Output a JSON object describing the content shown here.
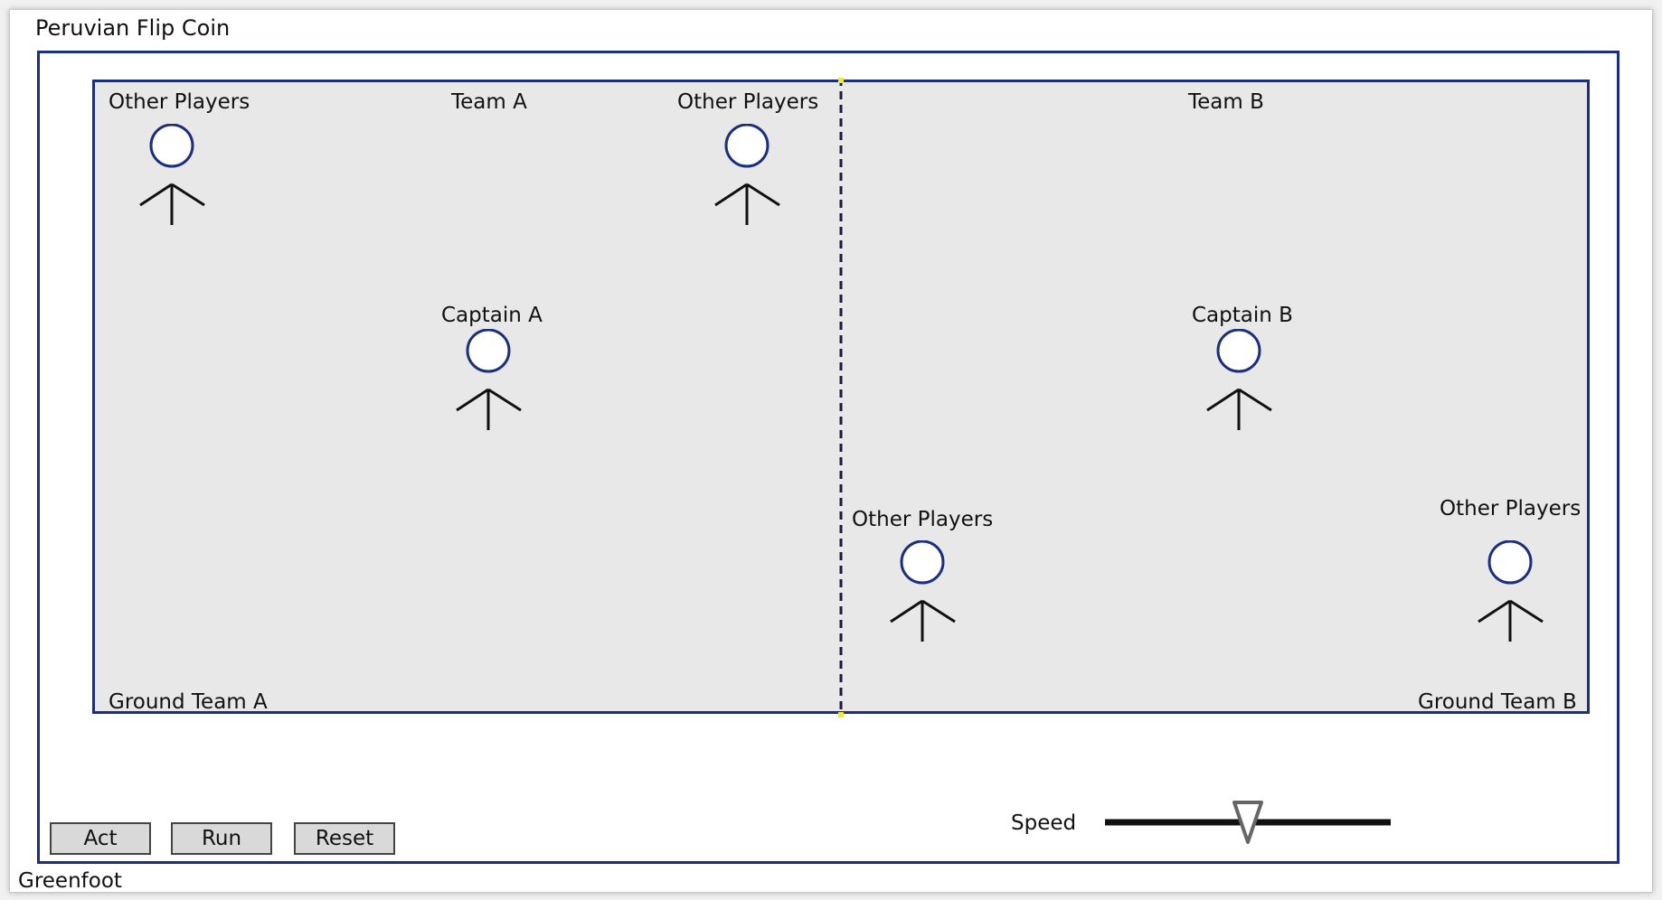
{
  "window": {
    "title": "Peruvian Flip Coin",
    "footer": "Greenfoot"
  },
  "field": {
    "team_a_label": "Team A",
    "team_b_label": "Team B",
    "ground_a_label": "Ground Team A",
    "ground_b_label": "Ground Team B",
    "players": [
      {
        "label": "Other Players"
      },
      {
        "label": "Other Players"
      },
      {
        "label": "Captain A"
      },
      {
        "label": "Captain B"
      },
      {
        "label": "Other Players"
      },
      {
        "label": "Other Players"
      }
    ]
  },
  "controls": {
    "act_label": "Act",
    "run_label": "Run",
    "reset_label": "Reset",
    "speed_label": "Speed",
    "speed_value": 0.5
  },
  "colors": {
    "border": "#1c2f7c",
    "field_bg": "#e8e8e8",
    "head_stroke": "#1c2f7c",
    "divider_handle": "#f2e832"
  }
}
